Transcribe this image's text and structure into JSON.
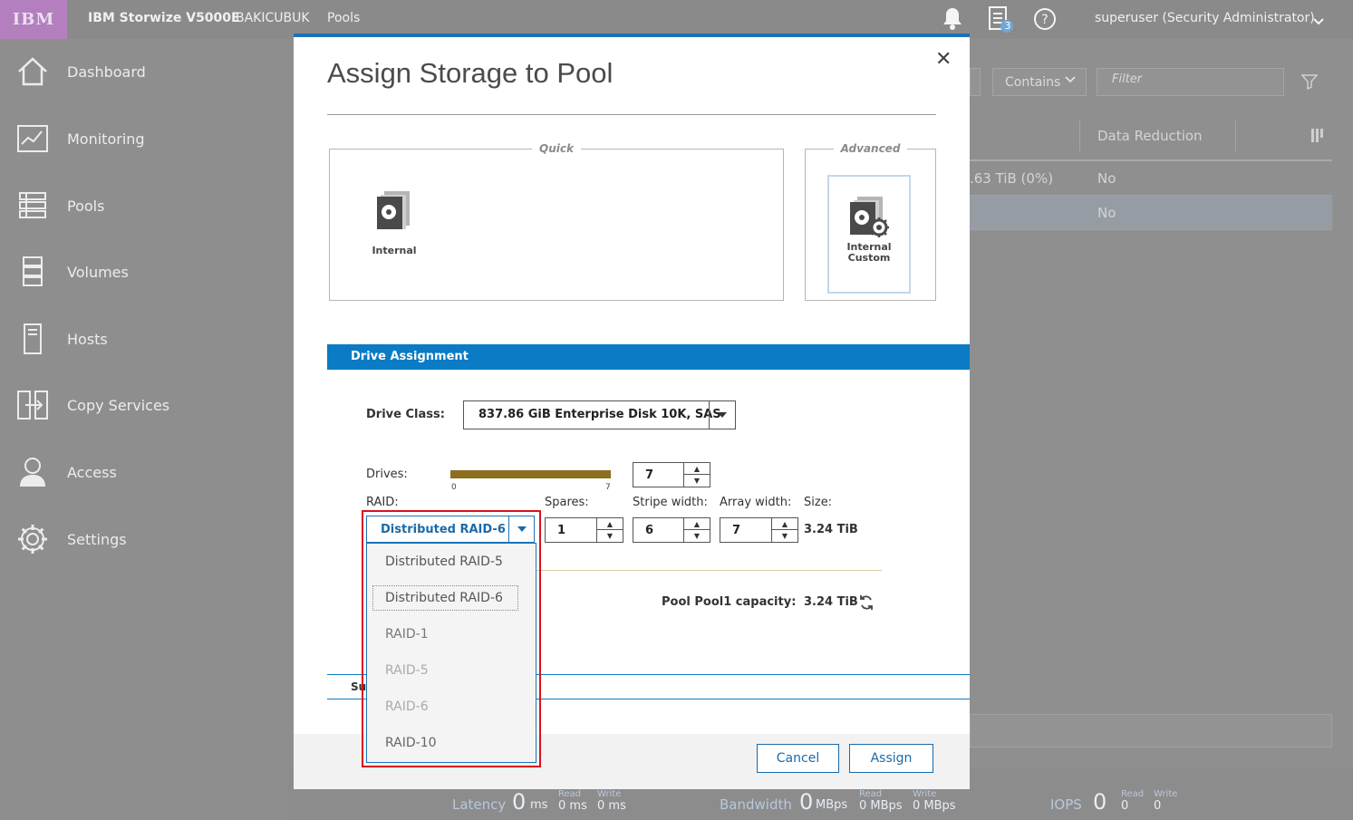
{
  "header": {
    "brand": "IBM",
    "product": "IBM Storwize V5000E",
    "system": "BAKICUBUK",
    "page": "Pools",
    "task_badge": "3",
    "user": "superuser (Security Administrator)"
  },
  "sidebar": {
    "items": [
      {
        "label": "Dashboard",
        "icon": "home-icon"
      },
      {
        "label": "Monitoring",
        "icon": "monitoring-icon"
      },
      {
        "label": "Pools",
        "icon": "pools-icon"
      },
      {
        "label": "Volumes",
        "icon": "volumes-icon"
      },
      {
        "label": "Hosts",
        "icon": "hosts-icon"
      },
      {
        "label": "Copy Services",
        "icon": "copy-services-icon"
      },
      {
        "label": "Access",
        "icon": "access-icon"
      },
      {
        "label": "Settings",
        "icon": "settings-icon"
      }
    ]
  },
  "background": {
    "filter_mode": "Contains",
    "filter_placeholder": "Filter",
    "column_header": "Data Reduction",
    "row1_capacity": ".63 TiB (0%)",
    "row1_reduction": "No",
    "row2_reduction": "No"
  },
  "status": {
    "latency_label": "Latency",
    "latency_value": "0",
    "latency_unit": "ms",
    "read_label": "Read",
    "write_label": "Write",
    "latency_read": "0 ms",
    "latency_write": "0 ms",
    "bandwidth_label": "Bandwidth",
    "bandwidth_value": "0",
    "bandwidth_unit": "MBps",
    "bandwidth_read": "0 MBps",
    "bandwidth_write": "0 MBps",
    "iops_label": "IOPS",
    "iops_value": "0",
    "iops_read": "0",
    "iops_write": "0"
  },
  "dialog": {
    "title": "Assign Storage to Pool",
    "quick_legend": "Quick",
    "advanced_legend": "Advanced",
    "quick_tile": "Internal",
    "advanced_tile_line1": "Internal",
    "advanced_tile_line2": "Custom",
    "section_title": "Drive Assignment",
    "drive_class_label": "Drive Class:",
    "drive_class_value": "837.86 GiB Enterprise Disk 10K, SAS",
    "drives_label": "Drives:",
    "drives_min": "0",
    "drives_max": "7",
    "drives_value": "7",
    "drives_fill_fraction": 1.0,
    "raid_label": "RAID:",
    "raid_value": "Distributed RAID-6",
    "raid_options": [
      "Distributed RAID-5",
      "Distributed RAID-6",
      "RAID-1",
      "RAID-5",
      "RAID-6",
      "RAID-10"
    ],
    "spares_label": "Spares:",
    "spares_value": "1",
    "stripe_label": "Stripe width:",
    "stripe_value": "6",
    "array_label": "Array width:",
    "array_value": "7",
    "size_label": "Size:",
    "size_value": "3.24 TiB",
    "capacity_label": "Pool Pool1 capacity:",
    "capacity_value": "3.24 TiB",
    "summary_fragment": "Su",
    "cancel_label": "Cancel",
    "assign_label": "Assign"
  },
  "colors": {
    "accent": "#0a7bc4",
    "highlight": "#d9131a",
    "slider": "#8b6f1f"
  }
}
